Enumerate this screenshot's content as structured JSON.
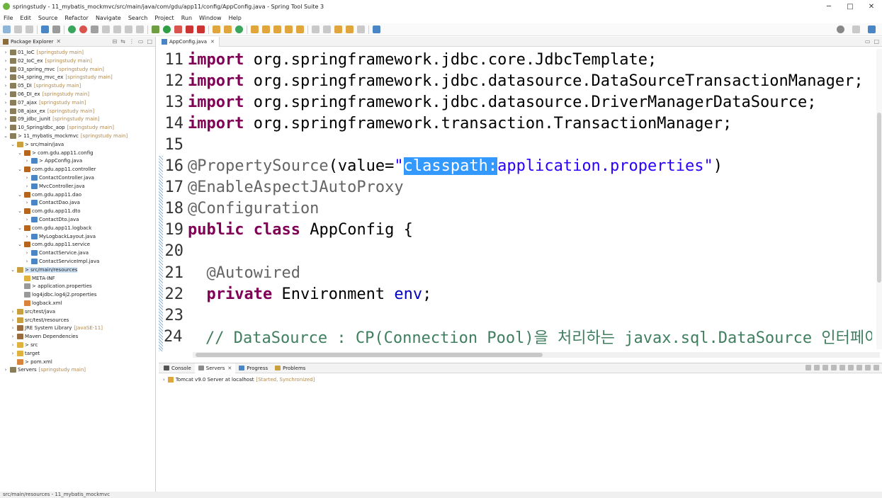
{
  "window": {
    "title": "springstudy - 11_mybatis_mockmvc/src/main/java/com/gdu/app11/config/AppConfig.java - Spring Tool Suite 3",
    "minimize": "─",
    "maximize": "□",
    "close": "✕"
  },
  "menus": [
    "File",
    "Edit",
    "Source",
    "Refactor",
    "Navigate",
    "Search",
    "Project",
    "Run",
    "Window",
    "Help"
  ],
  "explorer": {
    "tab_label": "Package Explorer",
    "items": [
      {
        "label": "01_IoC",
        "dec": "[springstudy main]",
        "depth": 0,
        "arrow": "›",
        "icon": "project"
      },
      {
        "label": "02_IoC_ex",
        "dec": "[springstudy main]",
        "depth": 0,
        "arrow": "›",
        "icon": "project"
      },
      {
        "label": "03_spring_mvc",
        "dec": "[springstudy main]",
        "depth": 0,
        "arrow": "›",
        "icon": "project"
      },
      {
        "label": "04_spring_mvc_ex",
        "dec": "[springstudy main]",
        "depth": 0,
        "arrow": "›",
        "icon": "project"
      },
      {
        "label": "05_DI",
        "dec": "[springstudy main]",
        "depth": 0,
        "arrow": "›",
        "icon": "project"
      },
      {
        "label": "06_DI_ex",
        "dec": "[springstudy main]",
        "depth": 0,
        "arrow": "›",
        "icon": "project"
      },
      {
        "label": "07_ajax",
        "dec": "[springstudy main]",
        "depth": 0,
        "arrow": "›",
        "icon": "project"
      },
      {
        "label": "08_ajax_ex",
        "dec": "[springstudy main]",
        "depth": 0,
        "arrow": "›",
        "icon": "project"
      },
      {
        "label": "09_jdbc_junit",
        "dec": "[springstudy main]",
        "depth": 0,
        "arrow": "›",
        "icon": "project"
      },
      {
        "label": "10_Spring/dbc_aop",
        "dec": "[springstudy main]",
        "depth": 0,
        "arrow": "›",
        "icon": "project"
      },
      {
        "label": "> 11_mybatis_mockmvc",
        "dec": "[springstudy main]",
        "depth": 0,
        "arrow": "⌄",
        "icon": "project"
      },
      {
        "label": "> src/main/java",
        "dec": "",
        "depth": 1,
        "arrow": "⌄",
        "icon": "srcfolder"
      },
      {
        "label": "> com.gdu.app11.config",
        "dec": "",
        "depth": 2,
        "arrow": "⌄",
        "icon": "package"
      },
      {
        "label": "> AppConfig.java",
        "dec": "",
        "depth": 3,
        "arrow": "›",
        "icon": "java"
      },
      {
        "label": "com.gdu.app11.controller",
        "dec": "",
        "depth": 2,
        "arrow": "⌄",
        "icon": "package"
      },
      {
        "label": "ContactController.java",
        "dec": "",
        "depth": 3,
        "arrow": "›",
        "icon": "java"
      },
      {
        "label": "MvcController.java",
        "dec": "",
        "depth": 3,
        "arrow": "›",
        "icon": "java"
      },
      {
        "label": "com.gdu.app11.dao",
        "dec": "",
        "depth": 2,
        "arrow": "⌄",
        "icon": "package"
      },
      {
        "label": "ContactDao.java",
        "dec": "",
        "depth": 3,
        "arrow": "›",
        "icon": "java"
      },
      {
        "label": "com.gdu.app11.dto",
        "dec": "",
        "depth": 2,
        "arrow": "⌄",
        "icon": "package"
      },
      {
        "label": "ContactDto.java",
        "dec": "",
        "depth": 3,
        "arrow": "›",
        "icon": "java"
      },
      {
        "label": "com.gdu.app11.logback",
        "dec": "",
        "depth": 2,
        "arrow": "⌄",
        "icon": "package"
      },
      {
        "label": "MyLogbackLayout.java",
        "dec": "",
        "depth": 3,
        "arrow": "›",
        "icon": "java"
      },
      {
        "label": "com.gdu.app11.service",
        "dec": "",
        "depth": 2,
        "arrow": "⌄",
        "icon": "package"
      },
      {
        "label": "ContactService.java",
        "dec": "",
        "depth": 3,
        "arrow": "›",
        "icon": "java"
      },
      {
        "label": "ContactServiceImpl.java",
        "dec": "",
        "depth": 3,
        "arrow": "›",
        "icon": "java"
      },
      {
        "label": "> src/main/resources",
        "dec": "",
        "depth": 1,
        "arrow": "⌄",
        "icon": "srcfolder",
        "selected": true
      },
      {
        "label": "META-INF",
        "dec": "",
        "depth": 2,
        "arrow": "",
        "icon": "folder"
      },
      {
        "label": "> application.properties",
        "dec": "",
        "depth": 2,
        "arrow": "",
        "icon": "file"
      },
      {
        "label": "log4jdbc.log4j2.properties",
        "dec": "",
        "depth": 2,
        "arrow": "",
        "icon": "file"
      },
      {
        "label": "logback.xml",
        "dec": "",
        "depth": 2,
        "arrow": "",
        "icon": "xml"
      },
      {
        "label": "src/test/java",
        "dec": "",
        "depth": 1,
        "arrow": "›",
        "icon": "srcfolder"
      },
      {
        "label": "src/test/resources",
        "dec": "",
        "depth": 1,
        "arrow": "›",
        "icon": "srcfolder"
      },
      {
        "label": "JRE System Library",
        "dec": "[JavaSE-11]",
        "depth": 1,
        "arrow": "›",
        "icon": "library"
      },
      {
        "label": "Maven Dependencies",
        "dec": "",
        "depth": 1,
        "arrow": "›",
        "icon": "library"
      },
      {
        "label": "> src",
        "dec": "",
        "depth": 1,
        "arrow": "›",
        "icon": "folder"
      },
      {
        "label": "target",
        "dec": "",
        "depth": 1,
        "arrow": "›",
        "icon": "folder"
      },
      {
        "label": "> pom.xml",
        "dec": "",
        "depth": 1,
        "arrow": "",
        "icon": "xml"
      },
      {
        "label": "Servers",
        "dec": "[springstudy main]",
        "depth": 0,
        "arrow": "›",
        "icon": "project"
      }
    ]
  },
  "editor": {
    "tab_label": "AppConfig.java",
    "lines": [
      {
        "n": "11",
        "tokens": [
          {
            "t": "import",
            "c": "kw"
          },
          {
            "t": " org.springframework.jdbc.core.JdbcTemplate;",
            "c": "plain"
          }
        ]
      },
      {
        "n": "12",
        "tokens": [
          {
            "t": "import",
            "c": "kw"
          },
          {
            "t": " org.springframework.jdbc.datasource.DataSourceTransactionManager;",
            "c": "plain"
          }
        ]
      },
      {
        "n": "13",
        "tokens": [
          {
            "t": "import",
            "c": "kw"
          },
          {
            "t": " org.springframework.jdbc.datasource.DriverManagerDataSource;",
            "c": "plain"
          }
        ]
      },
      {
        "n": "14",
        "tokens": [
          {
            "t": "import",
            "c": "kw"
          },
          {
            "t": " org.springframework.transaction.TransactionManager;",
            "c": "plain"
          }
        ]
      },
      {
        "n": "15",
        "tokens": []
      },
      {
        "n": "16",
        "tokens": [
          {
            "t": "@PropertySource",
            "c": "ann"
          },
          {
            "t": "(value=",
            "c": "plain"
          },
          {
            "t": "\"",
            "c": "str"
          },
          {
            "t": "classpath:",
            "c": "sel"
          },
          {
            "t": "application.properties\"",
            "c": "str"
          },
          {
            "t": ")",
            "c": "plain"
          }
        ]
      },
      {
        "n": "17",
        "tokens": [
          {
            "t": "@EnableAspectJAutoProxy",
            "c": "ann"
          }
        ]
      },
      {
        "n": "18",
        "tokens": [
          {
            "t": "@Configuration",
            "c": "ann"
          }
        ]
      },
      {
        "n": "19",
        "tokens": [
          {
            "t": "public",
            "c": "kw"
          },
          {
            "t": " ",
            "c": "plain"
          },
          {
            "t": "class",
            "c": "kw"
          },
          {
            "t": " AppConfig {",
            "c": "plain"
          }
        ]
      },
      {
        "n": "20",
        "tokens": []
      },
      {
        "n": "21",
        "tokens": [
          {
            "t": "  @Autowired",
            "c": "ann"
          }
        ]
      },
      {
        "n": "22",
        "tokens": [
          {
            "t": "  ",
            "c": "plain"
          },
          {
            "t": "private",
            "c": "kw"
          },
          {
            "t": " Environment ",
            "c": "plain"
          },
          {
            "t": "env",
            "c": "field"
          },
          {
            "t": ";",
            "c": "plain"
          }
        ]
      },
      {
        "n": "23",
        "tokens": []
      },
      {
        "n": "24",
        "tokens": [
          {
            "t": "  // DataSource : CP(Connection Pool)을 처리하는 javax.sql.DataSource 인터페이",
            "c": "com"
          }
        ]
      }
    ]
  },
  "console": {
    "tabs": [
      "Console",
      "Servers",
      "Progress",
      "Problems"
    ],
    "active_tab": "Servers",
    "server": {
      "name": "Tomcat v9.0 Server at localhost",
      "status": "[Started, Synchronized]"
    }
  },
  "statusbar": {
    "text": "src/main/resources - 11_mybatis_mockmvc"
  },
  "colors": {
    "keyword": "#7f0055",
    "annotation": "#646464",
    "string": "#2a00ff",
    "field": "#0000c0",
    "comment": "#3f7f5f",
    "selection": "#3399ff"
  }
}
